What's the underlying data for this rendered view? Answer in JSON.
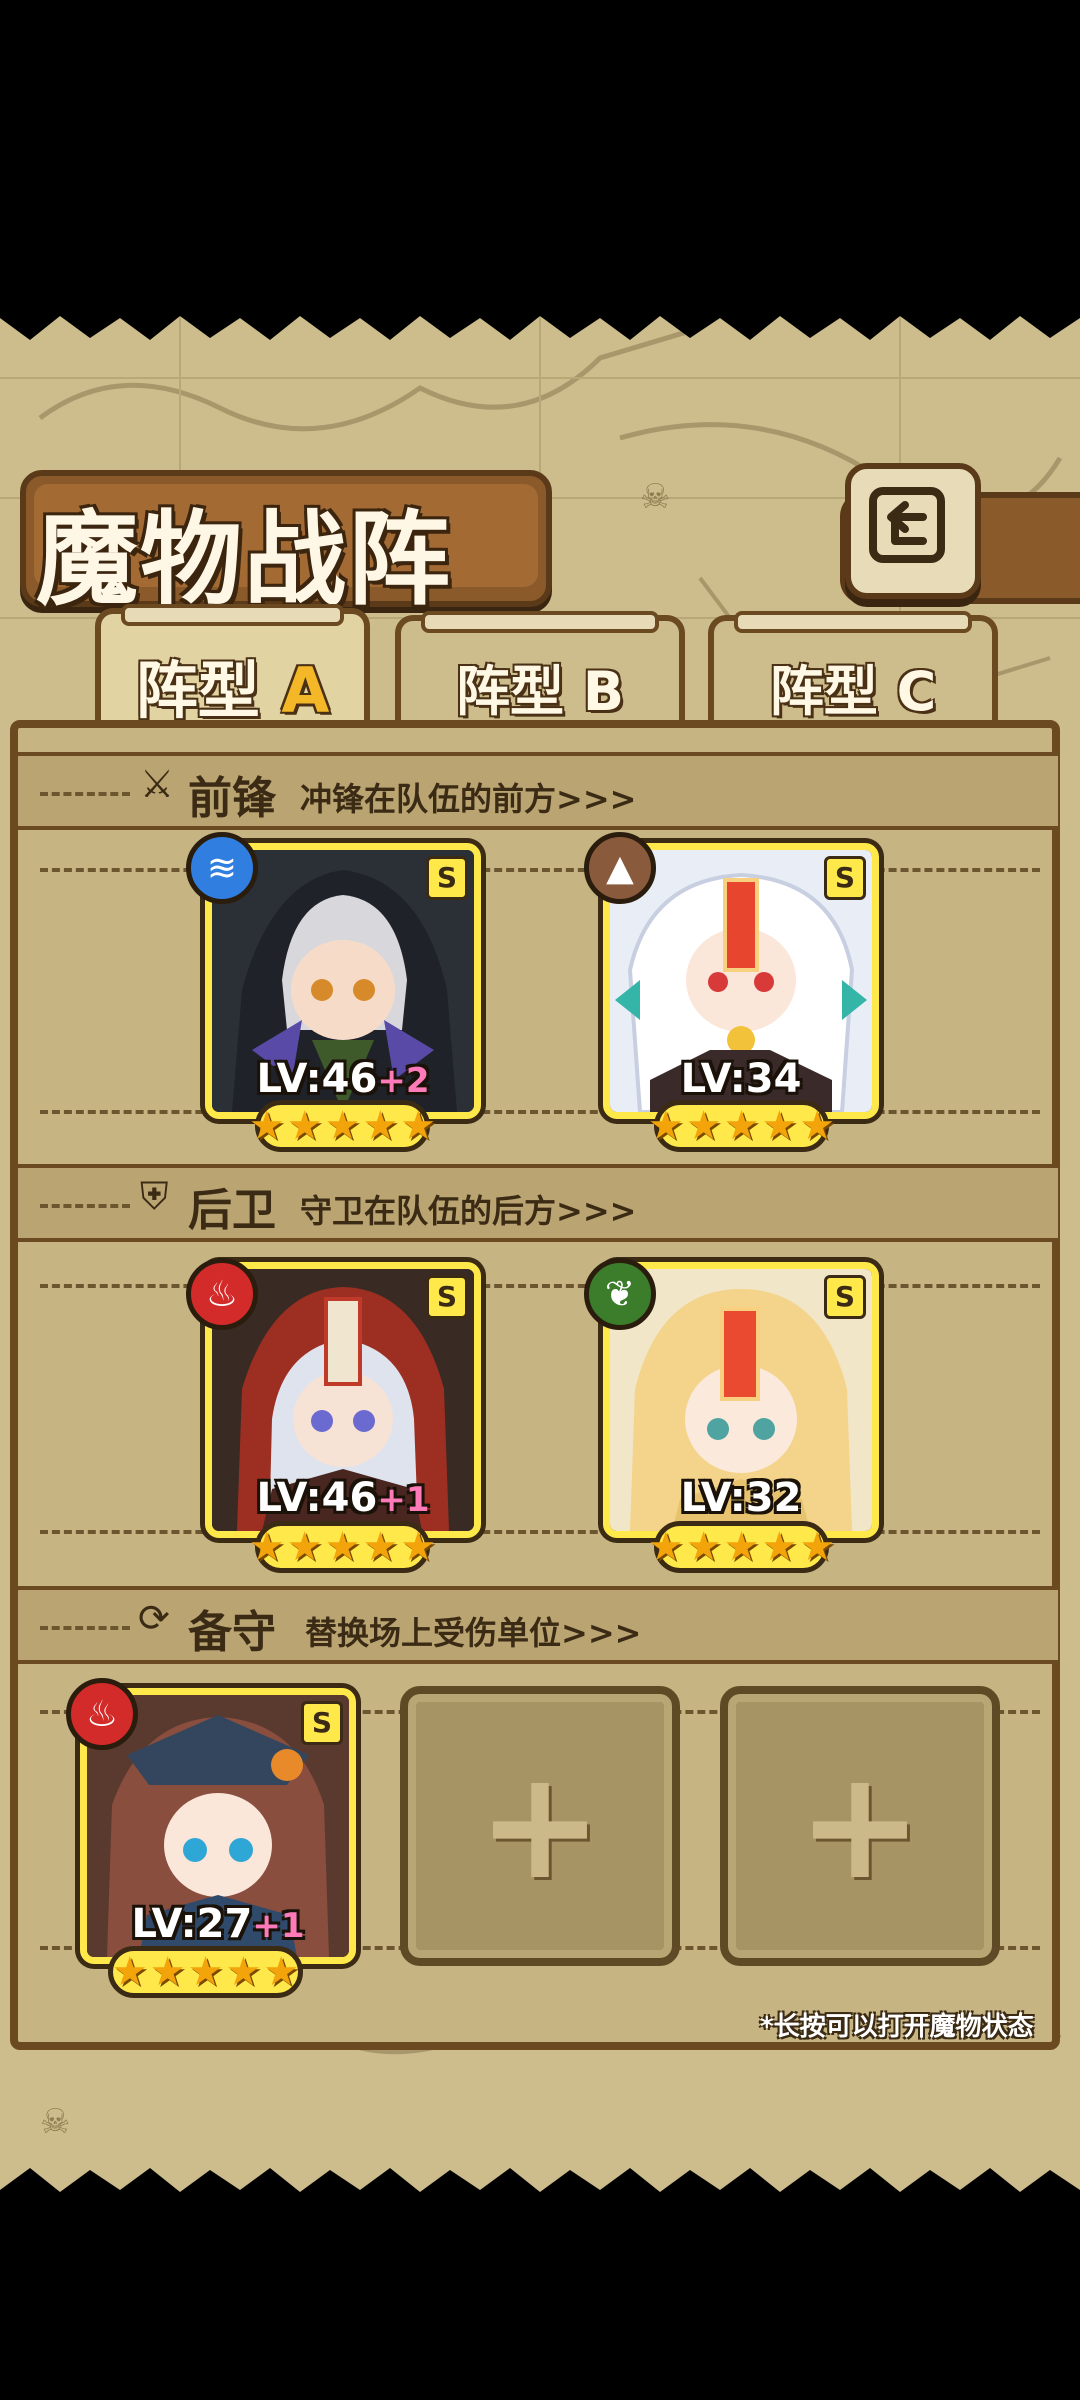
{
  "title": "魔物战阵",
  "tabs": [
    {
      "label": "阵型",
      "letter": "A",
      "active": true
    },
    {
      "label": "阵型",
      "letter": "B",
      "active": false
    },
    {
      "label": "阵型",
      "letter": "C",
      "active": false
    }
  ],
  "sections": {
    "front": {
      "title": "前锋",
      "desc": "冲锋在队伍的前方>>>",
      "icon": "sword-icon"
    },
    "rear": {
      "title": "后卫",
      "desc": "守卫在队伍的后方>>>",
      "icon": "shield-icon"
    },
    "reserve": {
      "title": "备守",
      "desc": "替换场上受伤单位>>>",
      "icon": "swap-icon"
    }
  },
  "monsters": {
    "front1": {
      "level": "LV:46",
      "bonus": "+2",
      "rank": "S",
      "stars": 5,
      "element": "water",
      "element_color": "#2f7ee0"
    },
    "front2": {
      "level": "LV:34",
      "bonus": "",
      "rank": "S",
      "stars": 5,
      "element": "earth",
      "element_color": "#8a5a3c"
    },
    "rear1": {
      "level": "LV:46",
      "bonus": "+1",
      "rank": "S",
      "stars": 5,
      "element": "fire",
      "element_color": "#d32a2a"
    },
    "rear2": {
      "level": "LV:32",
      "bonus": "",
      "rank": "S",
      "stars": 5,
      "element": "wood",
      "element_color": "#3c7d2c"
    },
    "reserve1": {
      "level": "LV:27",
      "bonus": "+1",
      "rank": "S",
      "stars": 5,
      "element": "fire",
      "element_color": "#d32a2a"
    }
  },
  "empty_slot": "+",
  "footnote": "*长按可以打开魔物状态",
  "colors": {
    "card_border": "#ffe84a",
    "wood": "#6b4a22",
    "parchment": "#cdbd8c"
  }
}
